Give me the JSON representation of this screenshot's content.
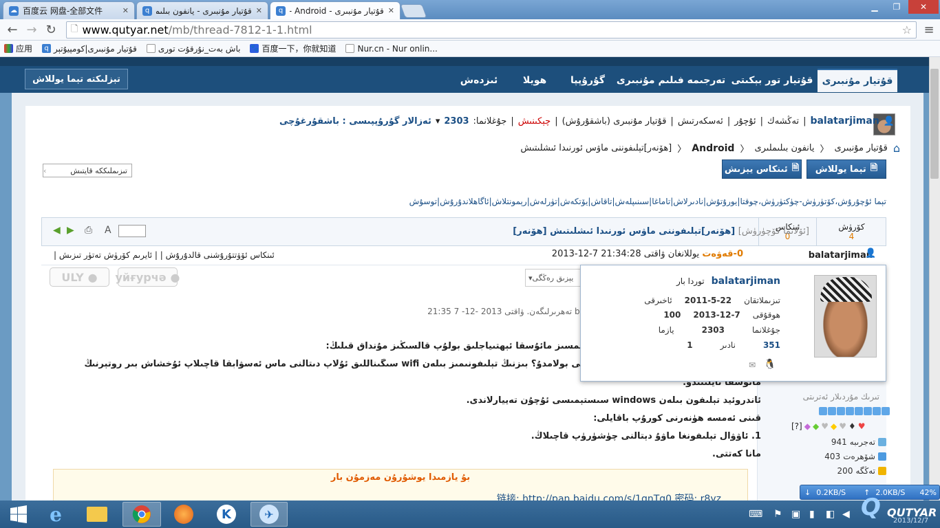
{
  "browser": {
    "tabs": [
      {
        "title": "百度云 网盘-全部文件"
      },
      {
        "title": "قۇتيار مۇنبىرى - يانفون بىلىملىرى"
      },
      {
        "title": "قۇتيار مۇنبىرى - Android -"
      }
    ],
    "url_host": "www.qutyar.net",
    "url_path": "/mb/thread-7812-1-1.html",
    "bookmarks": [
      {
        "label": "应用"
      },
      {
        "label": "قۇتيار مۇنبىرى|كومپيۇتېر"
      },
      {
        "label": "باش بەت_نۇرقۇت تورى"
      },
      {
        "label": "百度一下，你就知道"
      },
      {
        "label": "Nur.cn - Nur onlin..."
      }
    ]
  },
  "site": {
    "nav": [
      {
        "label": "قۇتيار مۇنبىرى"
      },
      {
        "label": "قۇتيار تور بېكىتى"
      },
      {
        "label": "تەرجىمە فىلىم مۇنبىرى"
      },
      {
        "label": "گۇرۇپپا"
      },
      {
        "label": "ھويلا"
      },
      {
        "label": "ئىزدەش"
      }
    ],
    "login_label": "تېزلىكتە تېما يوللاش",
    "userline": {
      "username": "balatarjiman",
      "links": [
        "تەڭشەك",
        "ئۇچۇر",
        "ئەسكەرتىش",
        "قۇتيار مۇنبىرى (باشقۇرۇش)",
        "چېكىنىش"
      ],
      "points_label": "جۇغلانما:",
      "points": "2303",
      "group_label": "ئەزالار گۇرۇپپىسى : باشقۇرغۇچى"
    },
    "breadcrumb": [
      "قۇتيار مۇنبىرى",
      "يانفون بىلىملىرى",
      "Android",
      "[ھۆنەر]تېلىفوننى ماۋس ئورنىدا ئىشلىتىش"
    ],
    "buttons": {
      "new_thread": "تېما يوللاش",
      "reply": "ئىنكاس يېزىش"
    },
    "sort_label": "تىزىملىككە قايتىش",
    "category_links": "تېما ئۇچۇرۇش،كۆتۈرۈش-چۈكتۈرۈش،چوقتا|يورۇتۇش|نادىرلاش|تاماغا|سىنىپلەش|تاقاش|يۆتكەش|تۈرلەش|رېمونتلاش|ئاگاھلاندۇرۇش|توسۇش",
    "thread": {
      "views_label": "كۆرۈش",
      "views": "4",
      "replies_label": "ئىنكاس",
      "replies": "0",
      "title": "[ھۆنەر]تېلىفوننى ماۋس ئورنىدا ئىشلىتىش",
      "title_tag": "[ھۆنەر]",
      "prev_next": "[ئۆلانما كۆچۈرۈش]"
    },
    "post": {
      "floor": "0-قەۋەت",
      "posted_label": "يوللانغان ۋاقتى",
      "posted_time": "2013-12-7 21:34:28",
      "author": "balatarjiman",
      "tools": "ئىنكاس ئۆۋتتۇرۇشنى قالدۇرۇش | | ئايرىم كۆرۈش تەتۈر تىزىش |",
      "badge_uly": "ULY",
      "badge_uyg": "уйғурчә",
      "lang_select": "يېزىق رەڭگى",
      "last_edit": "بۇ يازمىنى ئاخىرىدا  balatarjiman  تەھرىرلىگەن. ۋاقتى  2013 -12- 7 21:35",
      "lines": [
        "بولىسا سىمسىز مائۇسقا ئېھتىياجلىق بولۇپ قالسىڭىز مۇنداق قىلىڭ:",
        "سىمسىز كىيبورتقا ئايلاندۇرۇپ ئىشلەتكىلى بولامدۇ؟ بىزنىڭ تېلىفونىمىز بىلەن wifi سىگىناللىق ئۇلاپ دىتالنى ماس ئەسۋابقا قاچىلاپ ئۇخشاش بىر روتېرنىڭ",
        "مائۇسقا ئايلىنىدۇ.",
        "ئاندروئيد تېلىفون بىلەن windows سىستېمىسى ئۇچۇن تەييارلاندى.",
        "قىنى ئەمسە ھۈنەرنى كورۇپ باقايلى:",
        "1. ئاۋۋال تېلىفونغا ماۋۇ دېتالنى چۈشۈرۈپ قاچىلاڭ.",
        "مانا كەتتى."
      ],
      "download_title": "بۇ يازمىدا يوشۇرۇن مەزمۇن بار",
      "download_link": "链接: http://pan.baidu.com/s/1qnTq0 密码: r8yz"
    },
    "card": {
      "username": "balatarjiman",
      "status": "توردا بار",
      "rows": [
        {
          "label": "تىزىملاتقان",
          "value": "2011-5-22",
          "label2": "ئاخىرقى"
        },
        {
          "label": "ھوقۇقى",
          "value": "2013-12-7",
          "value2": "100"
        },
        {
          "label": "جۇغلانما",
          "value": "2303",
          "label2": "يازما"
        },
        {
          "label": "نادىر",
          "value": "351",
          "value2": "1"
        }
      ]
    },
    "usercol": {
      "rank": "تىرىك مۇردىلار ئەترىتى",
      "stats": [
        {
          "label": "تەجرىبە",
          "value": "941"
        },
        {
          "label": "شۆھرەت",
          "value": "403"
        },
        {
          "label": "تەڭگە",
          "value": "200"
        }
      ]
    }
  },
  "taskbar": {
    "net_down": "0.2KB/S",
    "net_up": "2.0KB/S",
    "cpu": "42%",
    "logo": "QUTYAR",
    "date": "2013/12/7"
  },
  "colors": {
    "header": "#1d4f7c",
    "accent": "#1b4f85",
    "orange": "#e07b00",
    "red": "#cc0000"
  }
}
